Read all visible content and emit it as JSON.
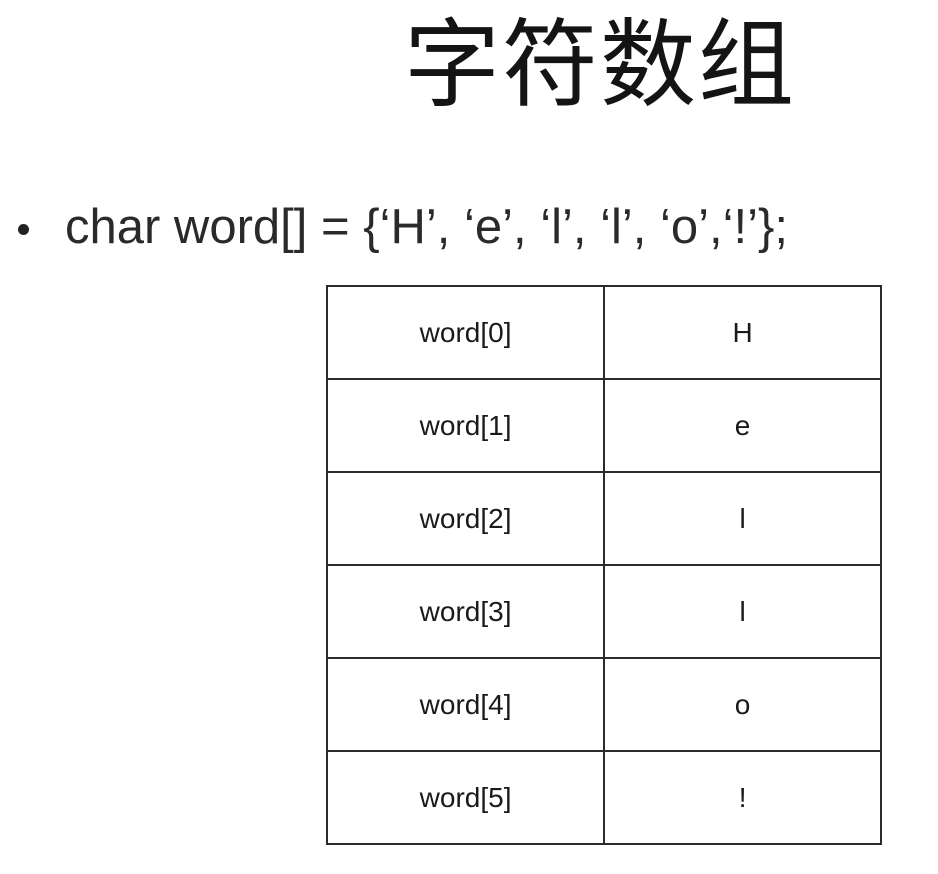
{
  "slide": {
    "title": "字符数组",
    "bullet": "char word[] = {‘H’, ‘e’, ‘l’, ‘l’, ‘o’,‘!’};"
  },
  "table": {
    "rows": [
      {
        "index": "word[0]",
        "value": "H"
      },
      {
        "index": "word[1]",
        "value": "e"
      },
      {
        "index": "word[2]",
        "value": "l"
      },
      {
        "index": "word[3]",
        "value": "l"
      },
      {
        "index": "word[4]",
        "value": "o"
      },
      {
        "index": "word[5]",
        "value": "!"
      }
    ]
  }
}
